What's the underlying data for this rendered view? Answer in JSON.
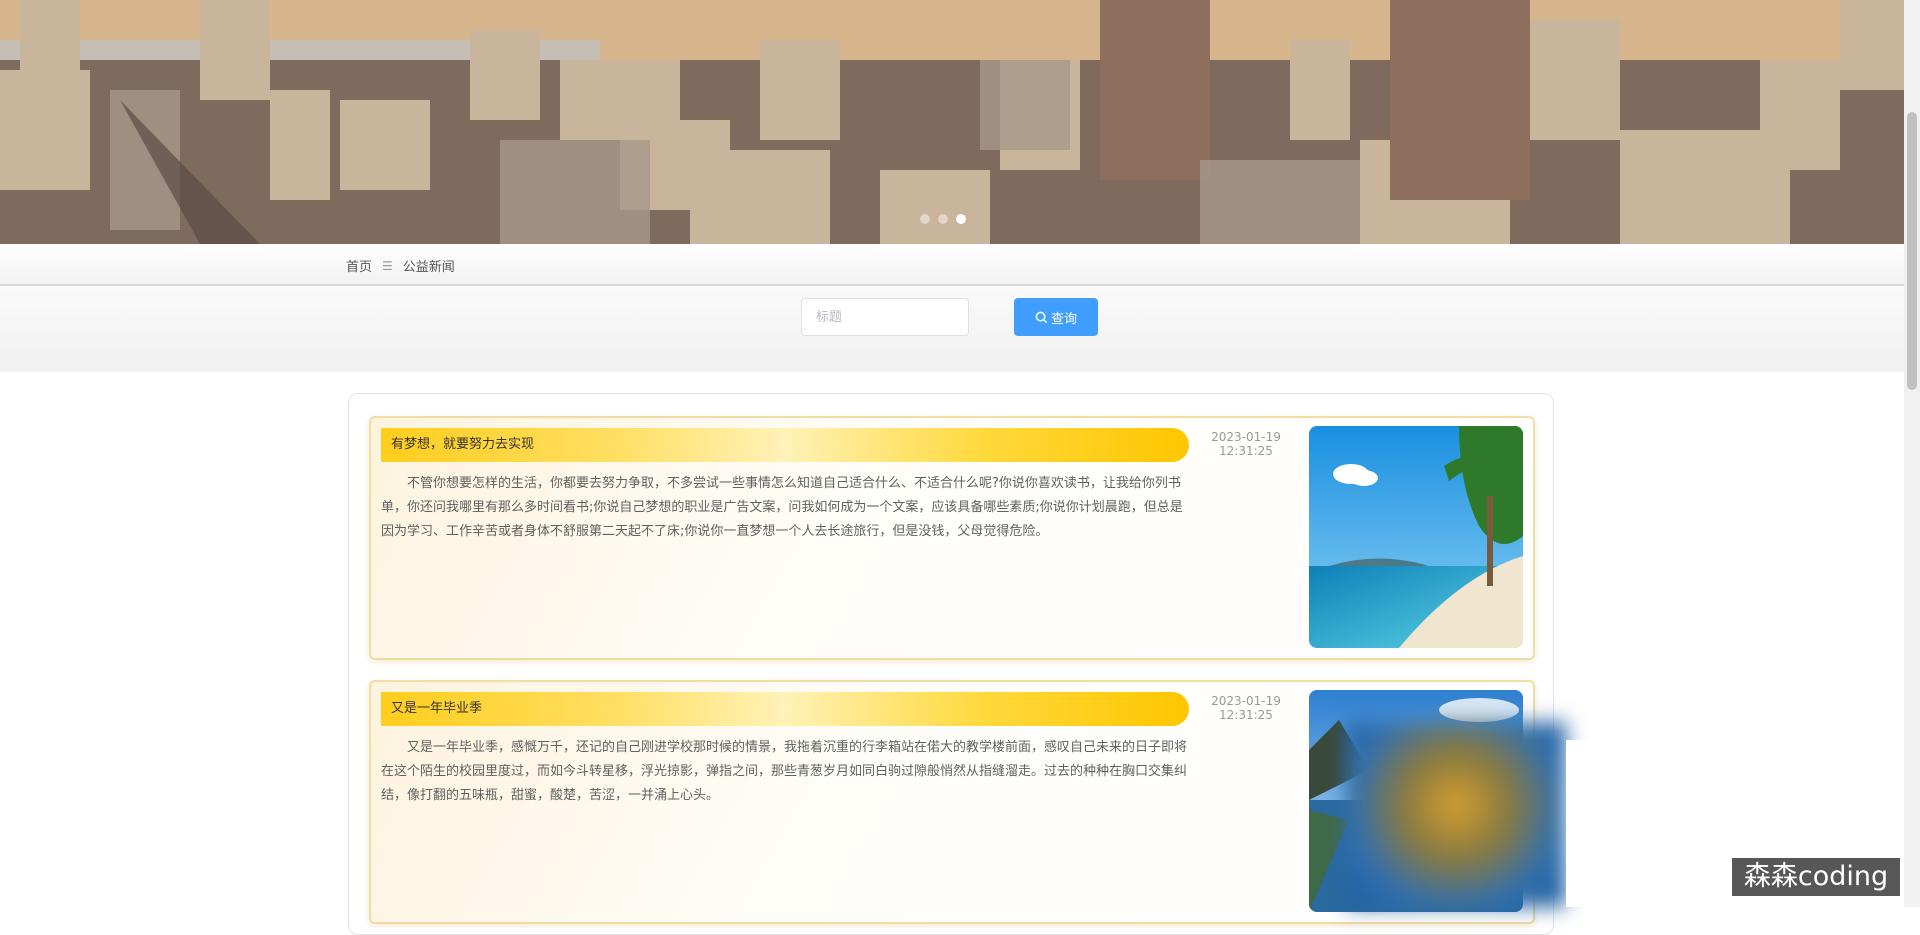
{
  "banner": {
    "dots": [
      false,
      false,
      true
    ]
  },
  "breadcrumb": {
    "home": "首页",
    "separator": "☰",
    "current": "公益新闻"
  },
  "search": {
    "placeholder": "标题",
    "button_label": "查询"
  },
  "news": [
    {
      "title": "有梦想，就要努力去实现",
      "date": "2023-01-19",
      "time": "12:31:25",
      "content": "不管你想要怎样的生活，你都要去努力争取，不多尝试一些事情怎么知道自己适合什么、不适合什么呢?你说你喜欢读书，让我给你列书单，你还问我哪里有那么多时间看书;你说自己梦想的职业是广告文案，问我如何成为一个文案，应该具备哪些素质;你说你计划晨跑，但总是因为学习、工作辛苦或者身体不舒服第二天起不了床;你说你一直梦想一个人去长途旅行，但是没钱，父母觉得危险。",
      "image": "beach-photo"
    },
    {
      "title": "又是一年毕业季",
      "date": "2023-01-19",
      "time": "12:31:25",
      "content": "又是一年毕业季，感慨万千，还记的自己刚进学校那时候的情景，我拖着沉重的行李箱站在偌大的教学楼前面，感叹自己未来的日子即将在这个陌生的校园里度过，而如今斗转星移，浮光掠影，弹指之间，那些青葱岁月如同白驹过隙般悄然从指缝溜走。过去的种种在胸口交集纠结，像打翻的五味瓶，甜蜜，酸楚，苦涩，一并涌上心头。",
      "image": "lake-mountain-photo"
    }
  ],
  "watermark": "森森coding"
}
